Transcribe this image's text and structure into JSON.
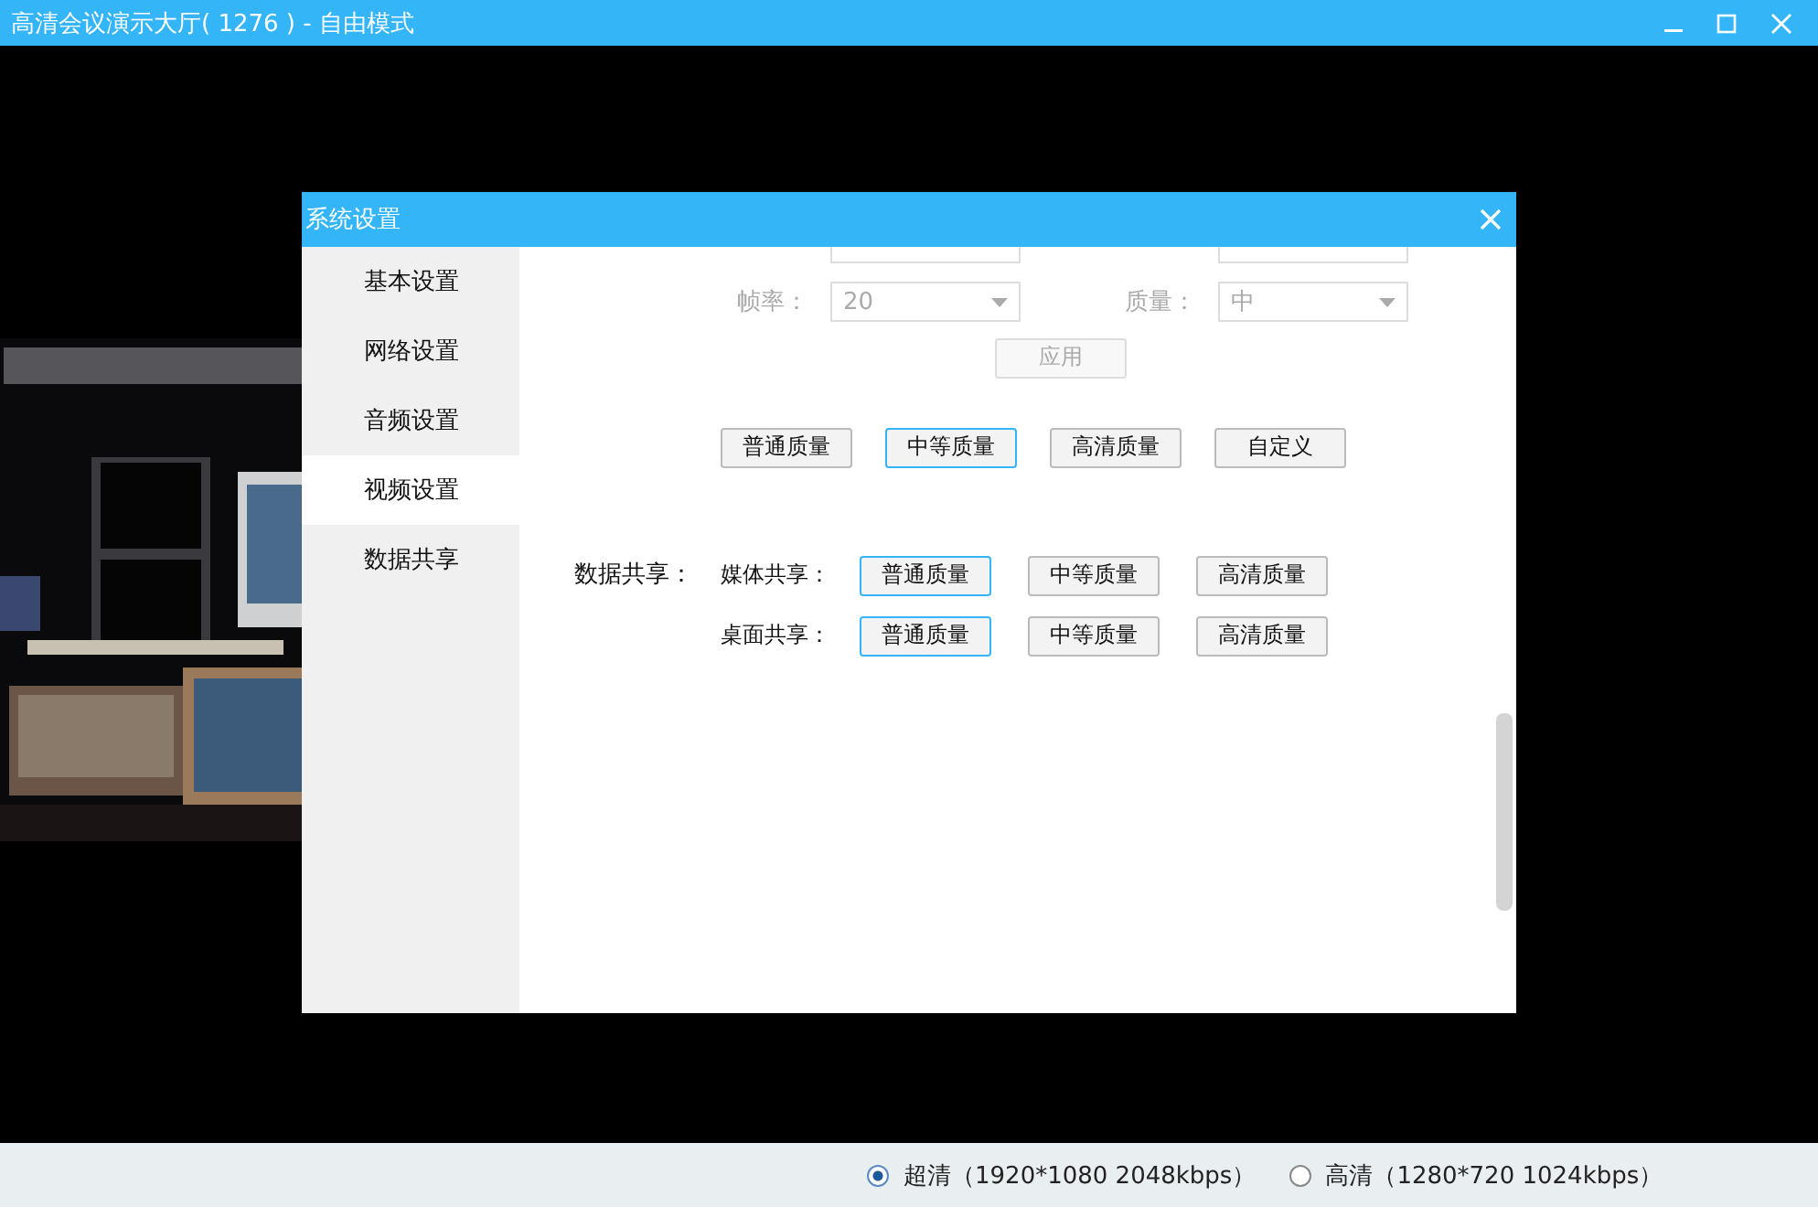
{
  "window": {
    "title": "高清会议演示大厅( 1276 ) - 自由模式"
  },
  "dialog": {
    "title": "系统设置",
    "sidebar": [
      {
        "label": "基本设置",
        "selected": false
      },
      {
        "label": "网络设置",
        "selected": false
      },
      {
        "label": "音频设置",
        "selected": false
      },
      {
        "label": "视频设置",
        "selected": true
      },
      {
        "label": "数据共享",
        "selected": false
      }
    ],
    "video": {
      "disabled": true,
      "fields": [
        {
          "label": "帧率：",
          "value": "20"
        },
        {
          "label": "质量：",
          "value": "中"
        }
      ],
      "apply": "应用",
      "presets": [
        {
          "label": "普通质量",
          "selected": false
        },
        {
          "label": "中等质量",
          "selected": true
        },
        {
          "label": "高清质量",
          "selected": false
        },
        {
          "label": "自定义",
          "selected": false
        }
      ]
    },
    "data_share": {
      "label": "数据共享：",
      "rows": [
        {
          "label": "媒体共享：",
          "options": [
            {
              "label": "普通质量",
              "selected": true
            },
            {
              "label": "中等质量",
              "selected": false
            },
            {
              "label": "高清质量",
              "selected": false
            }
          ]
        },
        {
          "label": "桌面共享：",
          "options": [
            {
              "label": "普通质量",
              "selected": true
            },
            {
              "label": "中等质量",
              "selected": false
            },
            {
              "label": "高清质量",
              "selected": false
            }
          ]
        }
      ]
    }
  },
  "status_bar": {
    "options": [
      {
        "label": "超清（1920*1080 2048kbps）",
        "selected": true
      },
      {
        "label": "高清（1280*720 1024kbps）",
        "selected": false
      }
    ]
  }
}
